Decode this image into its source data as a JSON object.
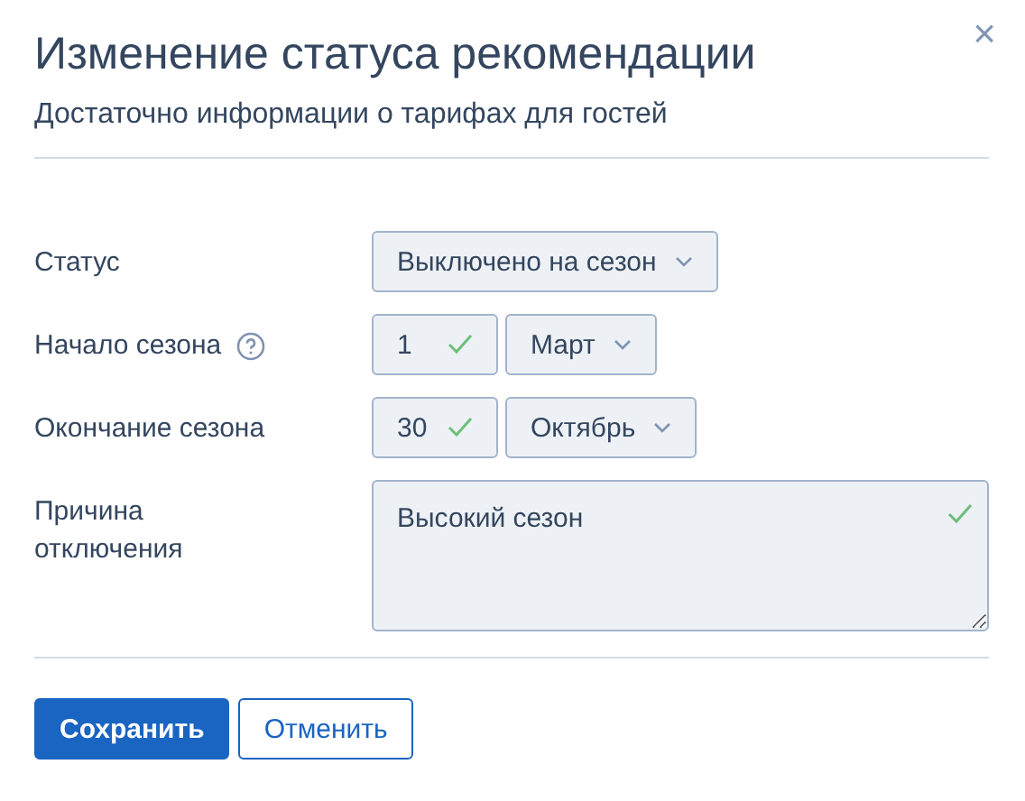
{
  "dialog": {
    "title": "Изменение статуса рекомендации",
    "subtitle": "Достаточно информации о тарифах для гостей",
    "close": "×"
  },
  "fields": [
    {
      "label": "Статус",
      "help": false,
      "controls": [
        {
          "kind": "select",
          "value": "Выключено на сезон"
        }
      ]
    },
    {
      "label": "Начало сезона",
      "help": true,
      "controls": [
        {
          "kind": "input",
          "value": "1",
          "valid": true
        },
        {
          "kind": "select",
          "value": "Март"
        }
      ]
    },
    {
      "label": "Окончание сезона",
      "help": false,
      "controls": [
        {
          "kind": "input",
          "value": "30",
          "valid": true
        },
        {
          "kind": "select",
          "value": "Октябрь"
        }
      ]
    },
    {
      "label": "Причина отключения",
      "help": false,
      "controls": [
        {
          "kind": "textarea",
          "value": "Высокий сезон",
          "valid": true
        }
      ]
    }
  ],
  "buttons": [
    {
      "label": "Сохранить",
      "primary": true
    },
    {
      "label": "Отменить",
      "primary": false
    }
  ]
}
